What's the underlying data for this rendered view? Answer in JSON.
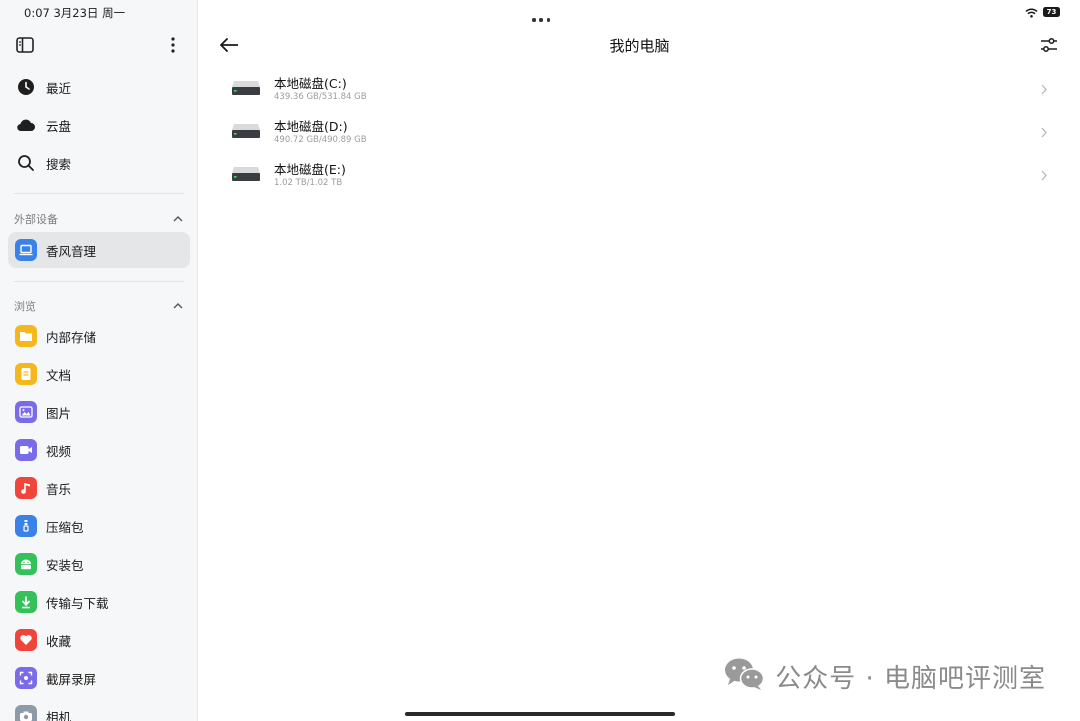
{
  "status_bar": {
    "time_date": "0:07  3月23日 周一",
    "battery": "73"
  },
  "sidebar": {
    "recent": {
      "label": "最近",
      "icon": "clock-icon"
    },
    "cloud": {
      "label": "云盘",
      "icon": "cloud-icon"
    },
    "search": {
      "label": "搜索",
      "icon": "search-icon"
    },
    "external_section": {
      "title": "外部设备"
    },
    "external_device": {
      "label": "香风音理",
      "icon": "laptop-icon"
    },
    "browse_section": {
      "title": "浏览"
    },
    "browse_items": [
      {
        "label": "内部存储",
        "icon": "folder-icon",
        "color": "#f5b81c"
      },
      {
        "label": "文档",
        "icon": "document-icon",
        "color": "#f5b81c"
      },
      {
        "label": "图片",
        "icon": "image-icon",
        "color": "#7a6be8"
      },
      {
        "label": "视频",
        "icon": "video-icon",
        "color": "#7a6be8"
      },
      {
        "label": "音乐",
        "icon": "music-icon",
        "color": "#f0453a"
      },
      {
        "label": "压缩包",
        "icon": "zip-icon",
        "color": "#3b82e8"
      },
      {
        "label": "安装包",
        "icon": "android-icon",
        "color": "#34c15a"
      },
      {
        "label": "传输与下载",
        "icon": "download-icon",
        "color": "#34c15a"
      },
      {
        "label": "收藏",
        "icon": "heart-icon",
        "color": "#f0453a"
      },
      {
        "label": "截屏录屏",
        "icon": "screenshot-icon",
        "color": "#7a6be8"
      },
      {
        "label": "相机",
        "icon": "camera-icon",
        "color": "#8e9aa8"
      }
    ]
  },
  "header": {
    "title": "我的电脑"
  },
  "drives": [
    {
      "name": "本地磁盘(C:)",
      "size": "439.36 GB/531.84 GB"
    },
    {
      "name": "本地磁盘(D:)",
      "size": "490.72 GB/490.89 GB"
    },
    {
      "name": "本地磁盘(E:)",
      "size": "1.02 TB/1.02 TB"
    }
  ],
  "watermark": {
    "text": "公众号 · 电脑吧评测室"
  }
}
